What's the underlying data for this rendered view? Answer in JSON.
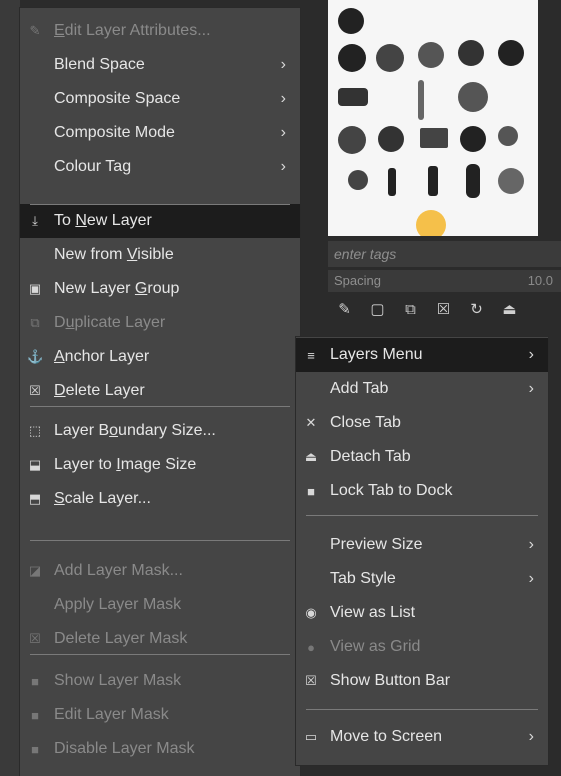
{
  "background": {
    "tags_placeholder": "enter tags",
    "spacing_label": "Spacing",
    "spacing_value": "10.0"
  },
  "layer_menu": {
    "items": [
      {
        "pre": "",
        "ul": "E",
        "post": "dit Layer Attributes...",
        "icon": "edit-attributes-icon",
        "disabled": true
      },
      {
        "pre": "Blend Space",
        "ul": "",
        "post": "",
        "submenu": true
      },
      {
        "pre": "Composite Space",
        "ul": "",
        "post": "",
        "submenu": true
      },
      {
        "pre": "Composite Mode",
        "ul": "",
        "post": "",
        "submenu": true
      },
      {
        "pre": "Colour Tag",
        "ul": "",
        "post": "",
        "submenu": true
      },
      {
        "pre": "To ",
        "ul": "N",
        "post": "ew Layer",
        "icon": "to-new-layer-icon",
        "selected": true
      },
      {
        "pre": "New from ",
        "ul": "V",
        "post": "isible"
      },
      {
        "pre": "New Layer ",
        "ul": "G",
        "post": "roup",
        "icon": "new-layer-group-icon"
      },
      {
        "pre": "D",
        "ul": "u",
        "post": "plicate Layer",
        "icon": "duplicate-layer-icon",
        "disabled": true
      },
      {
        "pre": "",
        "ul": "A",
        "post": "nchor Layer",
        "icon": "anchor-icon"
      },
      {
        "pre": "",
        "ul": "D",
        "post": "elete Layer",
        "icon": "delete-layer-icon"
      },
      {
        "pre": "Layer B",
        "ul": "o",
        "post": "undary Size...",
        "icon": "layer-boundary-icon"
      },
      {
        "pre": "Layer to ",
        "ul": "I",
        "post": "mage Size",
        "icon": "layer-to-image-icon"
      },
      {
        "pre": "",
        "ul": "S",
        "post": "cale Layer...",
        "icon": "scale-layer-icon"
      },
      {
        "pre": "Add Layer Mask...",
        "ul": "",
        "post": "",
        "icon": "add-mask-icon",
        "disabled": true
      },
      {
        "pre": "Apply Layer Mask",
        "ul": "",
        "post": "",
        "disabled": true
      },
      {
        "pre": "Delete Layer Mask",
        "ul": "",
        "post": "",
        "icon": "delete-mask-icon",
        "disabled": true
      },
      {
        "pre": "Show Layer Mask",
        "ul": "",
        "post": "",
        "icon": "checkbox-icon",
        "disabled": true
      },
      {
        "pre": "Edit Layer Mask",
        "ul": "",
        "post": "",
        "icon": "checkbox-icon",
        "disabled": true
      },
      {
        "pre": "Disable Layer Mask",
        "ul": "",
        "post": "",
        "icon": "checkbox-icon",
        "disabled": true
      }
    ]
  },
  "tab_menu": {
    "items": [
      {
        "label": "Layers Menu",
        "icon": "menu-icon",
        "submenu": true,
        "selected": true
      },
      {
        "label": "Add Tab",
        "submenu": true
      },
      {
        "label": "Close Tab",
        "icon": "close-icon"
      },
      {
        "label": "Detach Tab",
        "icon": "detach-icon"
      },
      {
        "label": "Lock Tab to Dock",
        "icon": "checkbox-icon"
      },
      {
        "label": "Preview Size",
        "submenu": true
      },
      {
        "label": "Tab Style",
        "submenu": true
      },
      {
        "label": "View as List",
        "icon": "radio-selected-icon"
      },
      {
        "label": "View as Grid",
        "icon": "radio-icon",
        "disabled": true
      },
      {
        "label": "Show Button Bar",
        "icon": "checkbox-checked-icon"
      },
      {
        "label": "Move to Screen",
        "icon": "screen-icon",
        "submenu": true
      }
    ]
  }
}
